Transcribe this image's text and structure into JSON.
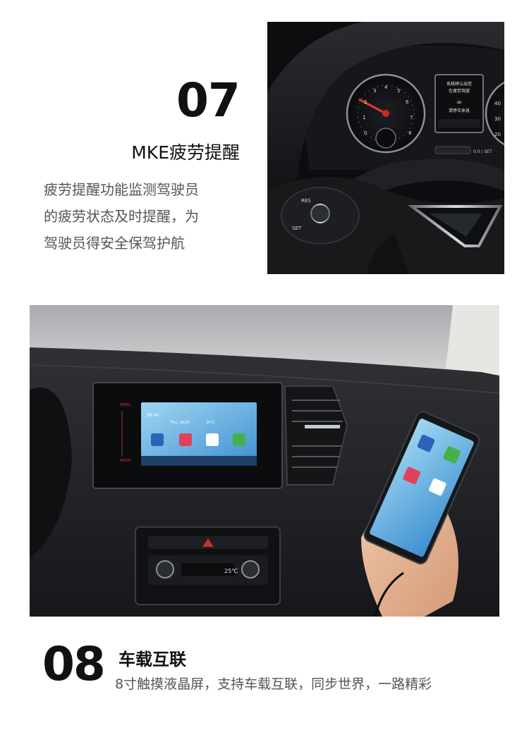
{
  "section07": {
    "number": "07",
    "title": "MKE疲劳提醒",
    "description_lines": [
      "疲劳提醒功能监测驾驶员",
      "的疲劳状态及时提醒，为",
      "驾驶员得安全保驾护航"
    ],
    "cluster": {
      "screen_lines": [
        "系统辨认出您",
        "在疲劳驾驶",
        "请停车休息"
      ],
      "left_button": "RES",
      "set_button": "SET",
      "od_button": "0.0 / SET"
    }
  },
  "section08": {
    "number": "08",
    "title": "车载互联",
    "description": "8寸触摸液晶屏，支持车载互联，同步世界，一路精彩",
    "screen": {
      "time": "08:40",
      "date": "Thu. 06/20",
      "temp": "25°C",
      "left_label": "MENU",
      "left_label2": "RADIO"
    },
    "climate_temp": "25℃"
  }
}
